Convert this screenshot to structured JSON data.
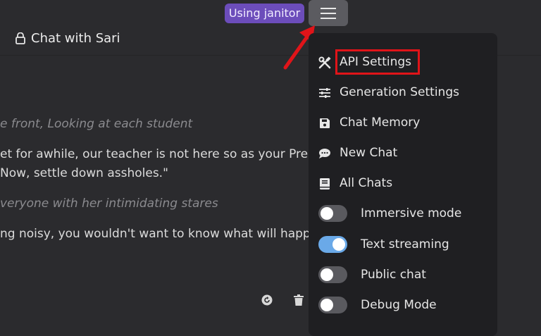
{
  "header": {
    "badge": "Using janitor",
    "chat_title": "Chat with Sari"
  },
  "chat": {
    "lines": [
      "e front, Looking at each student",
      "et for awhile, our teacher is not here so as your Presid",
      "Now, settle down assholes.\"",
      "veryone with her intimidating stares",
      "ng noisy, you wouldn't want to know what will happe"
    ]
  },
  "menu": {
    "items": [
      {
        "label": "API Settings",
        "icon": "tools-icon"
      },
      {
        "label": "Generation Settings",
        "icon": "sliders-icon"
      },
      {
        "label": "Chat Memory",
        "icon": "save-icon"
      },
      {
        "label": "New Chat",
        "icon": "chat-bubble-icon"
      },
      {
        "label": "All Chats",
        "icon": "book-icon"
      }
    ],
    "toggles": [
      {
        "label": "Immersive mode",
        "on": false
      },
      {
        "label": "Text streaming",
        "on": true
      },
      {
        "label": "Public chat",
        "on": false
      },
      {
        "label": "Debug Mode",
        "on": false
      }
    ]
  },
  "colors": {
    "accent_purple": "#6c4dbb",
    "toggle_on": "#6aa9e8",
    "highlight_red": "#e01419"
  }
}
